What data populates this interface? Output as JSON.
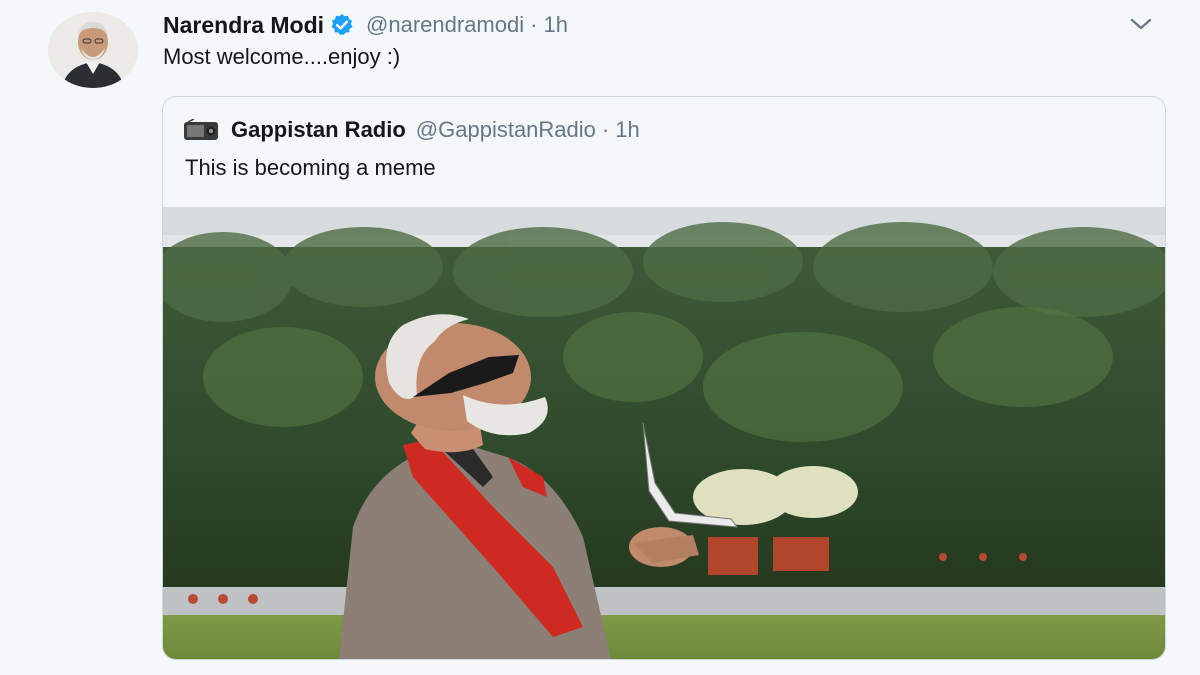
{
  "tweet": {
    "author_name": "Narendra Modi",
    "author_handle": "@narendramodi",
    "separator": "·",
    "time": "1h",
    "text": "Most welcome....enjoy :)"
  },
  "quoted_tweet": {
    "author_name": "Gappistan Radio",
    "author_handle": "@GappistanRadio",
    "separator": "·",
    "time": "1h",
    "text": "This is becoming a meme",
    "media_description": "photo"
  },
  "icons": {
    "verified": "verified-badge-icon",
    "menu": "chevron-down-icon",
    "quoted_avatar": "radio-icon"
  },
  "colors": {
    "background": "#f5f8fa",
    "verified_blue": "#1da1f2",
    "secondary_text": "#657786",
    "border": "#ccd6dd"
  }
}
